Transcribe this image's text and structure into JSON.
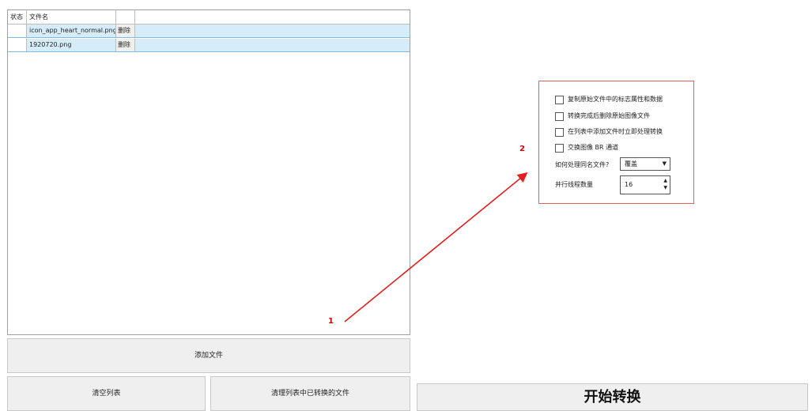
{
  "file_table": {
    "columns": {
      "status": "状态",
      "filename": "文件名"
    },
    "rows": [
      {
        "filename": "icon_app_heart_normal.png",
        "delete_label": "删除"
      },
      {
        "filename": "1920720.png",
        "delete_label": "删除"
      }
    ]
  },
  "buttons": {
    "add_file": "添加文件",
    "clear_list": "清空列表",
    "clean_converted": "清理列表中已转换的文件",
    "start_convert": "开始转换"
  },
  "options": {
    "copy_metadata": "复制原始文件中的标志属性和数据",
    "delete_after_convert": "转换完成后删除原始图像文件",
    "convert_on_add": "在列表中添加文件时立即处理转换",
    "swap_br": "交换图像 BR 通道",
    "same_name_label": "如何处理同名文件?",
    "same_name_value": "覆盖",
    "threads_label": "并行线程数量",
    "threads_value": "16"
  },
  "annotations": {
    "marker1": "1",
    "marker2": "2",
    "color": "#e02020"
  }
}
